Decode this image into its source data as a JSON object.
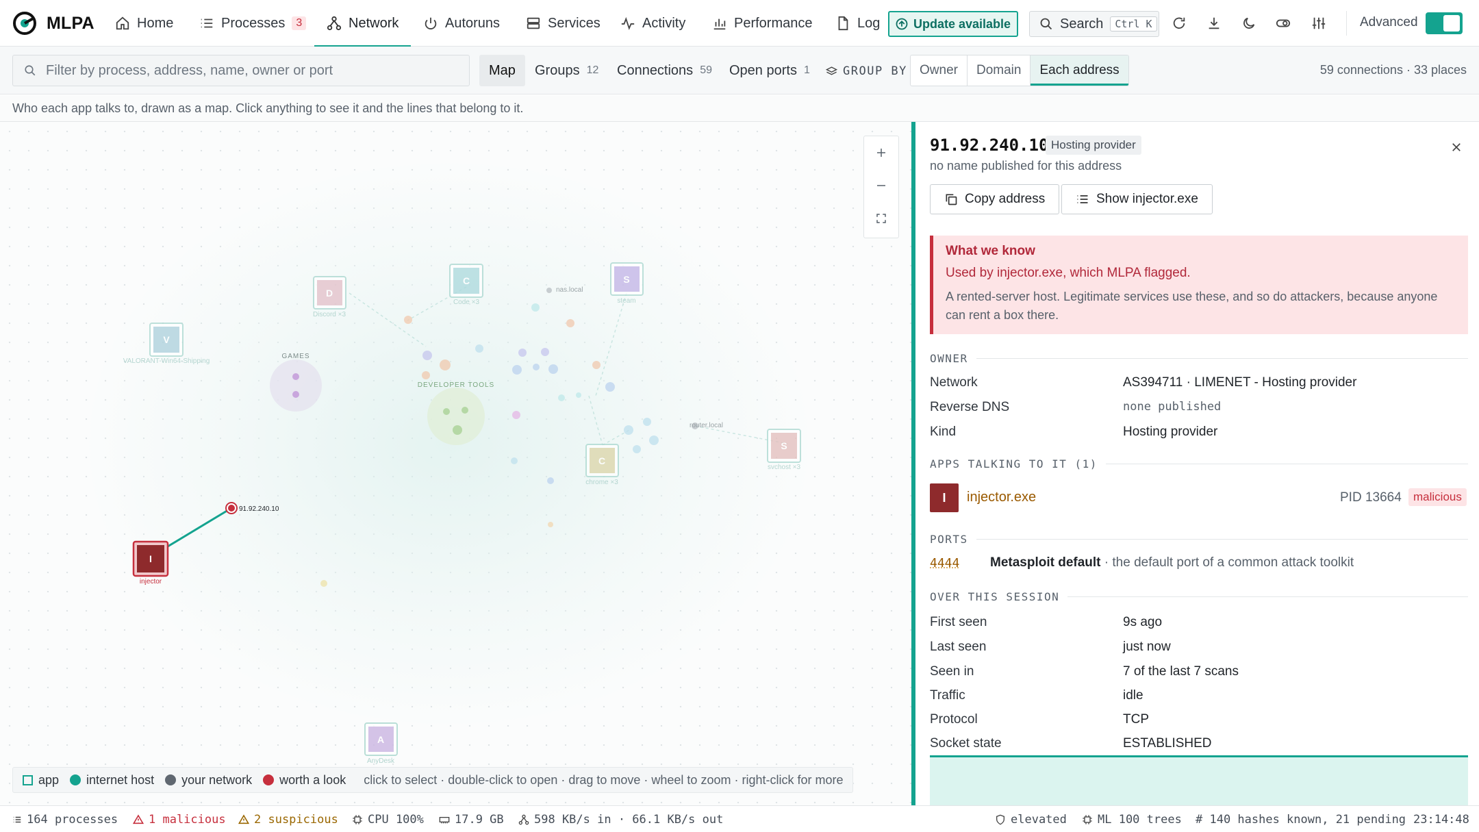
{
  "app": {
    "name": "MLPA"
  },
  "nav": {
    "home": "Home",
    "processes": "Processes",
    "processes_badge": "3",
    "network": "Network",
    "autoruns": "Autoruns",
    "services": "Services",
    "activity": "Activity",
    "performance": "Performance",
    "log": "Log",
    "update": "Update available",
    "search": "Search",
    "search_kbd": "Ctrl K",
    "advanced": "Advanced"
  },
  "filter": {
    "placeholder": "Filter by process, address, name, owner or port",
    "tabs": {
      "map": "Map",
      "groups": "Groups",
      "groups_count": "12",
      "connections": "Connections",
      "connections_count": "59",
      "open_ports": "Open ports",
      "open_ports_count": "1"
    },
    "group_by_label": "GROUP BY",
    "group_by": {
      "owner": "Owner",
      "domain": "Domain",
      "each": "Each address"
    },
    "summary": "59 connections · 33 places"
  },
  "hint": "Who each app talks to, drawn as a map. Click anything to see it and the lines that belong to it.",
  "map": {
    "clusters": {
      "games": "GAMES",
      "dev": "DEVELOPER TOOLS"
    },
    "apps": {
      "discord": {
        "letter": "D",
        "label": "Discord ×3"
      },
      "code": {
        "letter": "C",
        "label": "Code ×3"
      },
      "steam": {
        "letter": "S",
        "label": "steam"
      },
      "valorant": {
        "letter": "V",
        "label": "VALORANT-Win64-Shipping"
      },
      "chrome": {
        "letter": "C",
        "label": "chrome ×3"
      },
      "svchost": {
        "letter": "S",
        "label": "svchost ×3"
      },
      "injector": {
        "letter": "I",
        "label": "injector"
      },
      "anydesk": {
        "letter": "A",
        "label": "AnyDesk"
      }
    },
    "hosts": {
      "nas": "nas.local",
      "router": "router.local",
      "selected": "91.92.240.10"
    },
    "legend": {
      "app": "app",
      "internet": "internet host",
      "network": "your network",
      "worth": "worth a look",
      "hint": "click to select · double-click to open · drag to move · wheel to zoom · right-click for more"
    },
    "colors": {
      "accent": "#14a38f",
      "danger": "#c62f3d"
    }
  },
  "detail": {
    "address": "91.92.240.10",
    "kind_chip": "Hosting provider",
    "subtitle": "no name published for this address",
    "copy_btn": "Copy address",
    "show_btn": "Show injector.exe",
    "know": {
      "heading": "What we know",
      "line1": "Used by injector.exe, which MLPA flagged.",
      "line2": "A rented-server host. Legitimate services use these, and so do attackers, because anyone can rent a box there."
    },
    "owner_section": "OWNER",
    "owner": [
      {
        "k": "Network",
        "v": "AS394711 · LIMENET - Hosting provider"
      },
      {
        "k": "Reverse DNS",
        "v": "none published"
      },
      {
        "k": "Kind",
        "v": "Hosting provider"
      }
    ],
    "apps_section": "APPS TALKING TO IT (1)",
    "app": {
      "letter": "I",
      "name": "injector.exe",
      "pid": "PID 13664",
      "status": "malicious"
    },
    "ports_section": "PORTS",
    "port": {
      "number": "4444",
      "name": "Metasploit default",
      "desc": " · the default port of a common attack toolkit"
    },
    "session_section": "OVER THIS SESSION",
    "session": [
      {
        "k": "First seen",
        "v": "9s ago"
      },
      {
        "k": "Last seen",
        "v": "just now"
      },
      {
        "k": "Seen in",
        "v": "7 of the last 7 scans"
      },
      {
        "k": "Traffic",
        "v": "idle"
      },
      {
        "k": "Protocol",
        "v": "TCP"
      },
      {
        "k": "Socket state",
        "v": "ESTABLISHED"
      }
    ]
  },
  "status": {
    "processes": "164 processes",
    "malicious": "1 malicious",
    "suspicious": "2 suspicious",
    "cpu": "CPU 100%",
    "mem": "17.9 GB",
    "net": "598 KB/s in · 66.1 KB/s out",
    "elevated": "elevated",
    "ml": "ML 100 trees",
    "hashes": "# 140 hashes known, 21 pending",
    "time": "23:14:48"
  }
}
